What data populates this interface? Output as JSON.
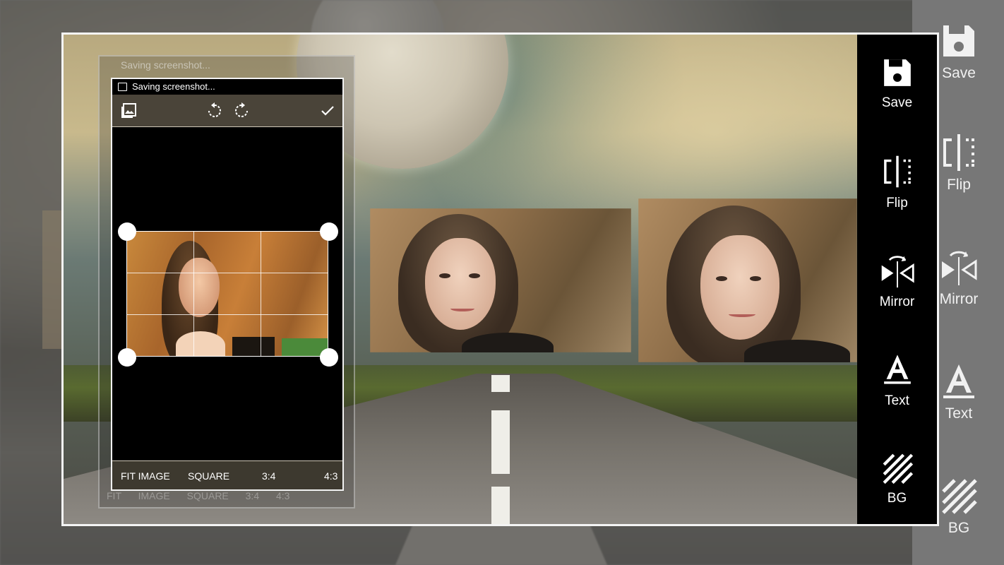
{
  "editor": {
    "toolbar": [
      {
        "id": "save",
        "label": "Save",
        "icon": "floppy-disk-icon"
      },
      {
        "id": "flip",
        "label": "Flip",
        "icon": "flip-icon"
      },
      {
        "id": "mirror",
        "label": "Mirror",
        "icon": "mirror-icon"
      },
      {
        "id": "text",
        "label": "Text",
        "icon": "text-icon"
      },
      {
        "id": "bg",
        "label": "BG",
        "icon": "background-pattern-icon"
      }
    ]
  },
  "ghost_toolbar": [
    {
      "label": "Save"
    },
    {
      "label": "Flip"
    },
    {
      "label": "Mirror"
    },
    {
      "label": "Text"
    },
    {
      "label": "BG"
    }
  ],
  "crop_dialog": {
    "title": "Saving screenshot...",
    "ghost_title": "Saving screenshot...",
    "icons": [
      "gallery-icon",
      "rotate-left-icon",
      "rotate-right-icon",
      "check-icon"
    ],
    "ratios": [
      "FIT IMAGE",
      "SQUARE",
      "3:4",
      "4:3"
    ],
    "ghost_ratios": "FIT IMAGE SQUARE 3:4 4:3"
  },
  "colors": {
    "toolbar_bg": "#000000",
    "frame_border": "#f4f4f4",
    "dialog_bar": "#4a4439"
  }
}
